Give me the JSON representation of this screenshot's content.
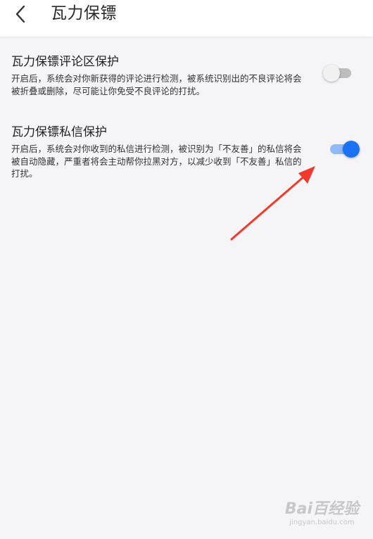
{
  "header": {
    "title": "瓦力保镖",
    "back_icon": "chevron-left-icon"
  },
  "settings": [
    {
      "title": "瓦力保镖评论区保护",
      "description": "开启后，系统会对你新获得的评论进行检测，被系统识别出的不良评论将会被折叠或删除，尽可能让你免受不良评论的打扰。",
      "enabled": false
    },
    {
      "title": "瓦力保镖私信保护",
      "description": "开启后，系统会对你收到的私信进行检测，被识别为「不友善」的私信将会被自动隐藏，严重者将会主动帮你拉黑对方，以减少收到「不友善」私信的打扰。",
      "enabled": true
    }
  ],
  "colors": {
    "accent": "#1a73f5",
    "toggle_on_track": "#8fb9f7",
    "toggle_off_track": "#bdbdbd",
    "toggle_off_knob": "#f1f1f1",
    "annotation_arrow": "#f23a2c"
  },
  "watermark": {
    "logo": "Bai百经验",
    "url": "jingyan.baidu.com"
  }
}
